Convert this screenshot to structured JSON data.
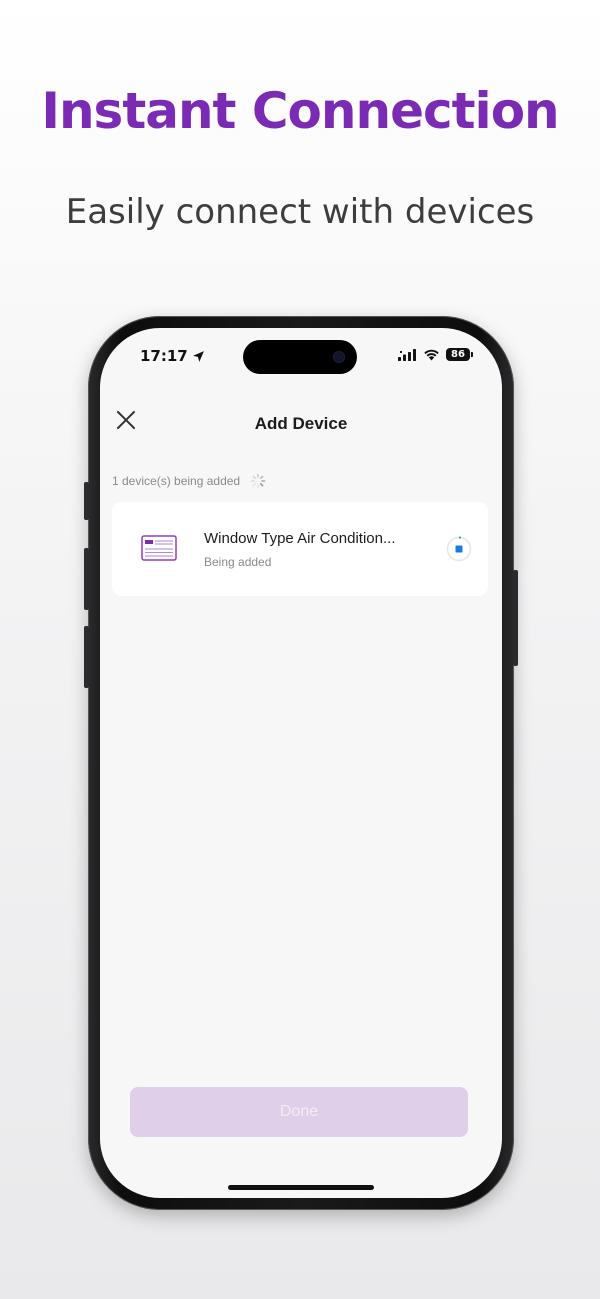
{
  "promo": {
    "headline": "Instant Connection",
    "subheadline": "Easily connect with devices"
  },
  "colors": {
    "accent": "#7b2ab3",
    "done_button_bg": "#e0cfe9",
    "indicator_blue": "#1a7ae8"
  },
  "status_bar": {
    "time": "17:17",
    "battery_level": "86",
    "icons": [
      "location-arrow-icon",
      "cellular-signal-icon",
      "wifi-icon",
      "battery-icon"
    ]
  },
  "header": {
    "title": "Add Device",
    "close_icon": "close-icon"
  },
  "progress": {
    "text": "1 device(s) being added"
  },
  "devices": [
    {
      "name": "Window Type Air Condition...",
      "status": "Being added",
      "icon": "air-conditioner-icon"
    }
  ],
  "footer": {
    "done_label": "Done"
  }
}
